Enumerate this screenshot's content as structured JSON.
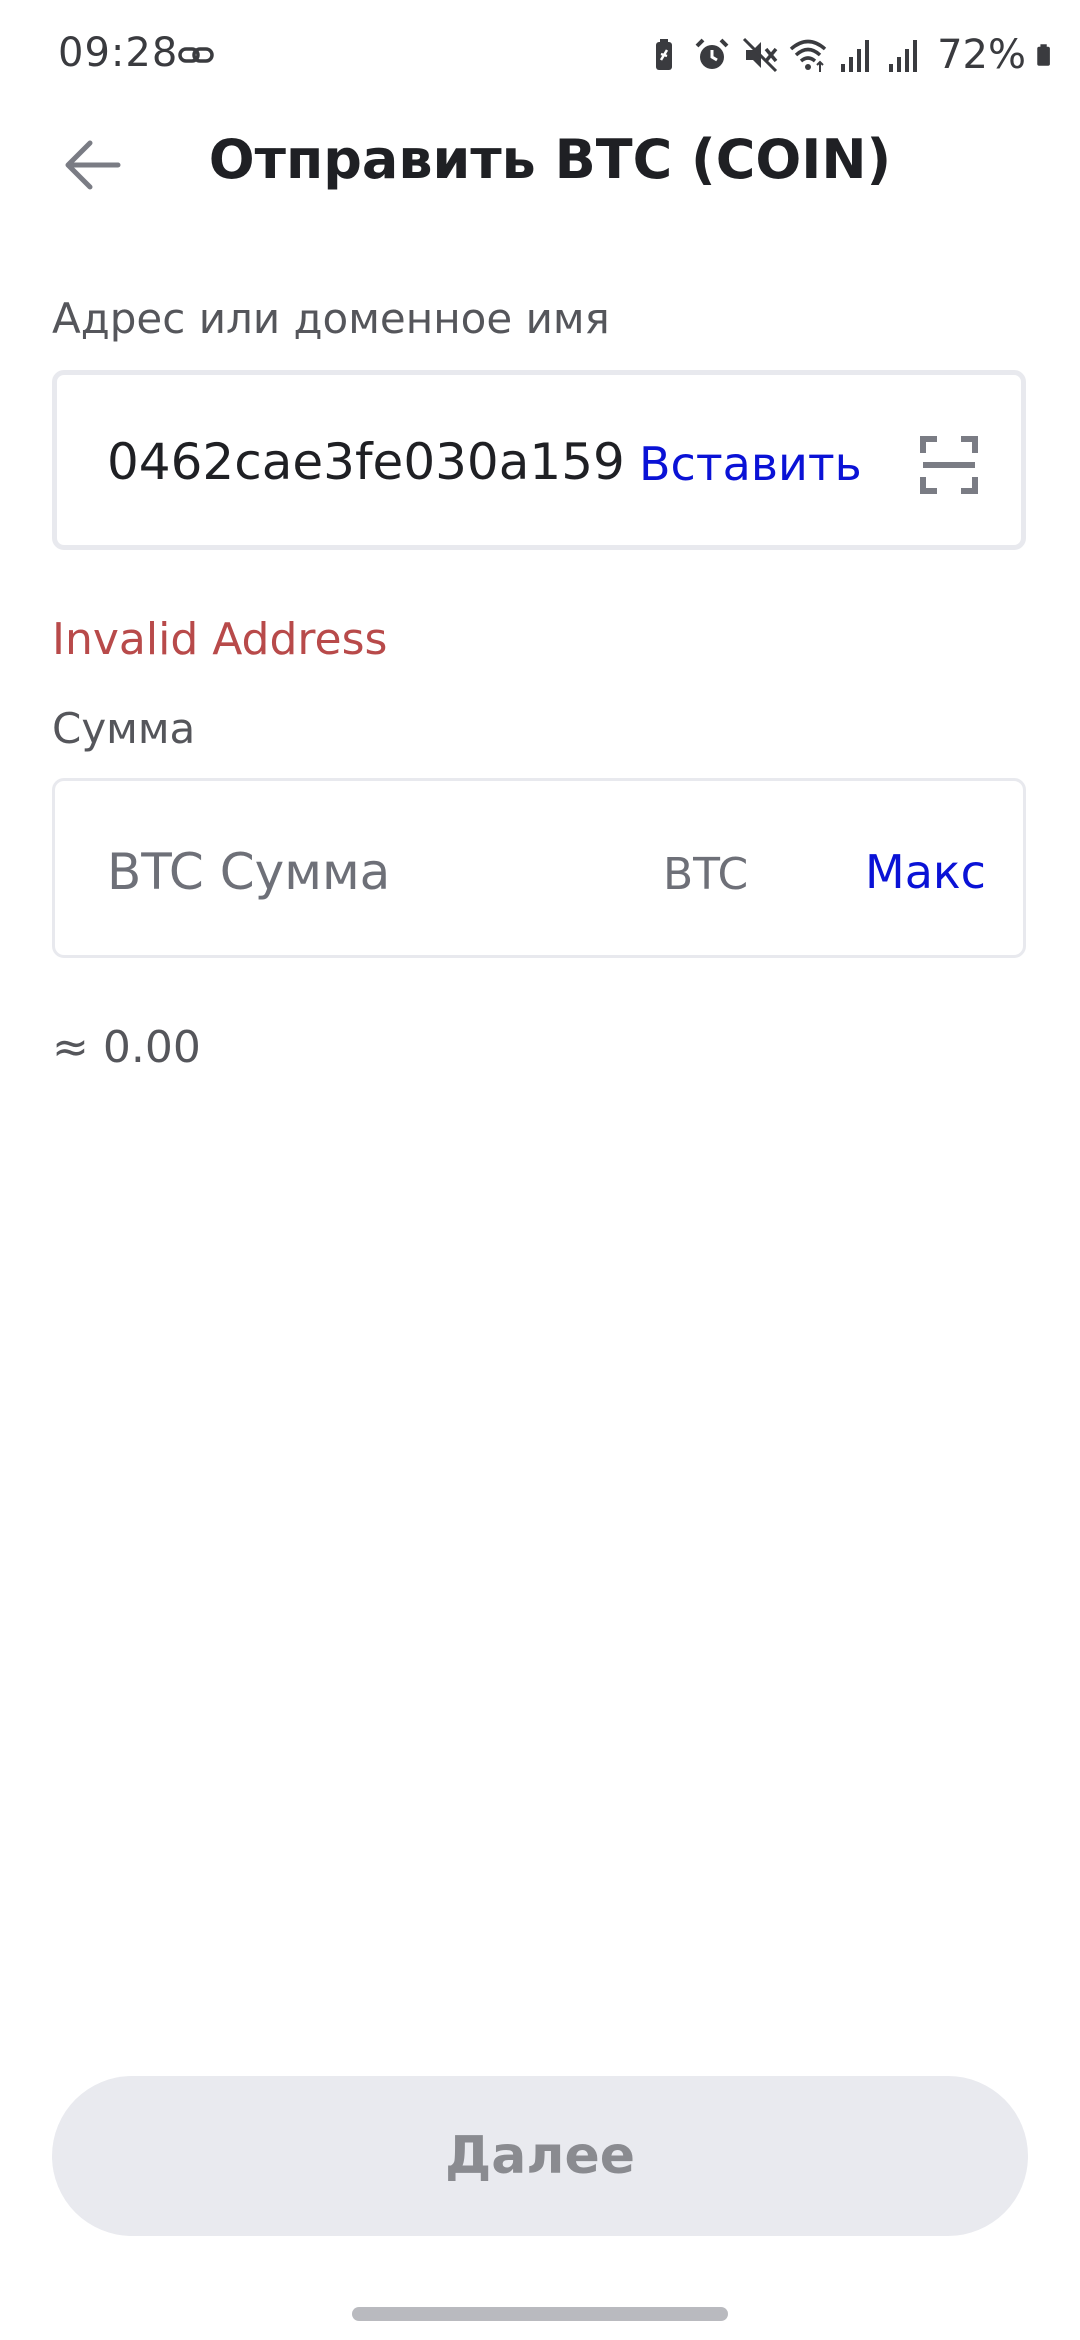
{
  "status_bar": {
    "time": "09:28",
    "battery": "72%",
    "icons": [
      "link-icon",
      "battery-saver-icon",
      "alarm-icon",
      "mute-icon",
      "wifi-icon",
      "signal-icon",
      "signal-icon",
      "battery-icon"
    ]
  },
  "header": {
    "back_icon": "arrow-left-icon",
    "title": "Отправить BTC (COIN)"
  },
  "address": {
    "label": "Адрес или доменное имя",
    "value": "0462cae3fe030a159",
    "paste_label": "Вставить",
    "scan_icon": "scan-icon",
    "error": "Invalid Address"
  },
  "amount": {
    "label": "Сумма",
    "placeholder": "BTC Сумма",
    "currency": "BTC",
    "max_label": "Макс",
    "approx": "≈ 0.00"
  },
  "footer": {
    "next_label": "Далее"
  },
  "colors": {
    "accent": "#0a12d6",
    "error": "#b84a4a",
    "disabled_button_bg": "#e9eaef",
    "border": "#e8e9ee"
  }
}
